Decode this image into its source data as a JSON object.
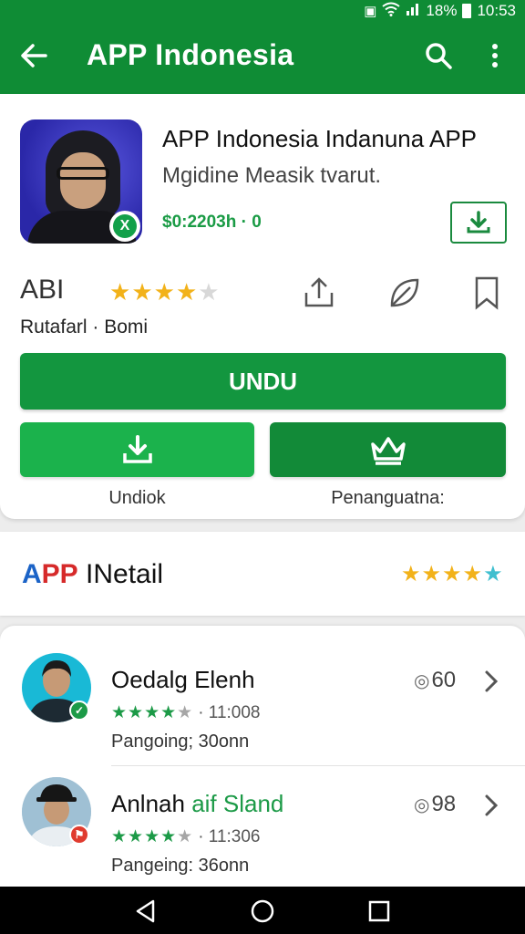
{
  "status_bar": {
    "battery": "18%",
    "time": "10:53"
  },
  "app_bar": {
    "title": "APP Indonesia",
    "back_icon": "arrow-left-icon",
    "search_icon": "search-icon",
    "more_icon": "more-vert-icon"
  },
  "app": {
    "name": "APP Indonesia Indanuna APP",
    "subtitle": "Mgidine Measik tvarut.",
    "size": "$0:2203h · 0",
    "badge_letter": "X",
    "short_label": "ABI",
    "rating": 4.5,
    "meta": "Rutafarl · Bomi"
  },
  "buttons": {
    "main": "UNDU",
    "left_label": "Undiok",
    "right_label": "Penanguatna:"
  },
  "detail": {
    "title_a": "A",
    "title_p": "PP",
    "title_rest": " INetail",
    "stars": 5
  },
  "reviews": [
    {
      "name": "Oedalg Elenh",
      "name_accent": "",
      "stars": 4.5,
      "rating_text": "· 11:008",
      "sub": "Pangoing; 30onn",
      "count": "60",
      "badge_color": "#1c9a47"
    },
    {
      "name": "Anlnah ",
      "name_accent": "aif Sland",
      "stars": 4.5,
      "rating_text": "· 11:306",
      "sub": "Pangeing: 36onn",
      "count": "98",
      "badge_color": "#e03b2f"
    }
  ],
  "colors": {
    "brand_green": "#0f8c35",
    "button_green": "#13963f",
    "star_gold": "#f2b21a"
  }
}
